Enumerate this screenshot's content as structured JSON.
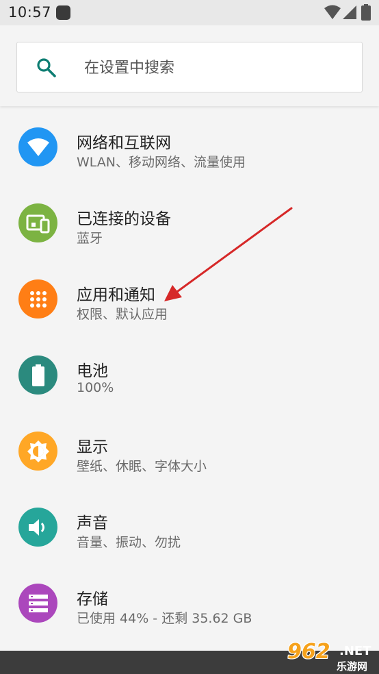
{
  "status_bar": {
    "time": "10:57"
  },
  "search": {
    "placeholder": "在设置中搜索"
  },
  "settings": [
    {
      "id": "network",
      "title": "网络和互联网",
      "subtitle": "WLAN、移动网络、流量使用",
      "color": "#2196f3",
      "icon": "wifi-icon"
    },
    {
      "id": "devices",
      "title": "已连接的设备",
      "subtitle": "蓝牙",
      "color": "#7cb342",
      "icon": "devices-icon"
    },
    {
      "id": "apps",
      "title": "应用和通知",
      "subtitle": "权限、默认应用",
      "color": "#ff7e15",
      "icon": "apps-grid-icon"
    },
    {
      "id": "battery",
      "title": "电池",
      "subtitle": "100%",
      "color": "#2b8a7e",
      "icon": "battery-icon"
    },
    {
      "id": "display",
      "title": "显示",
      "subtitle": "壁纸、休眠、字体大小",
      "color": "#ffa726",
      "icon": "brightness-icon"
    },
    {
      "id": "sound",
      "title": "声音",
      "subtitle": "音量、振动、勿扰",
      "color": "#26a69a",
      "icon": "volume-icon"
    },
    {
      "id": "storage",
      "title": "存储",
      "subtitle": "已使用 44% - 还剩 35.62 GB",
      "color": "#ab47bc",
      "icon": "storage-icon"
    }
  ],
  "annotation": {
    "arrow_color": "#d62828"
  },
  "watermark": {
    "brand": "962",
    "domain": ".NET",
    "subtitle": "乐游网"
  }
}
